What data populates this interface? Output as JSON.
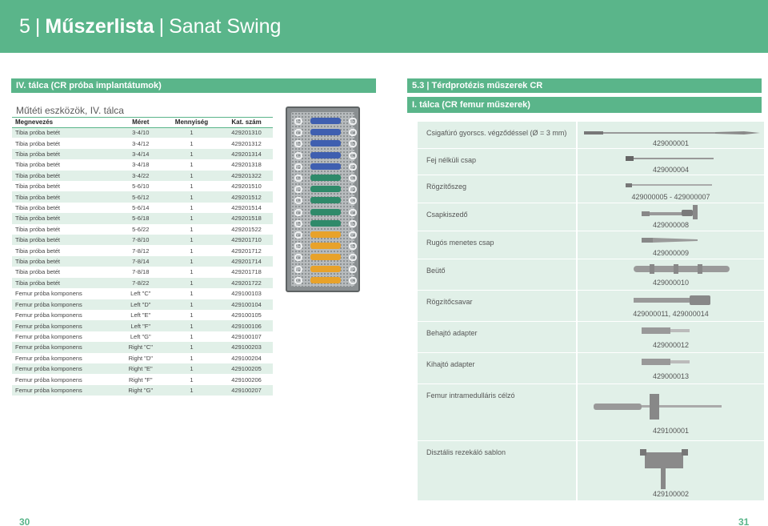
{
  "header": {
    "num": "5",
    "title": "Műszerlista",
    "subtitle": "Sanat Swing"
  },
  "left": {
    "bar_title": "IV. tálca (CR próba implantátumok)",
    "subtitle": "Műtéti eszközök, IV. tálca",
    "columns": [
      "Megnevezés",
      "Méret",
      "Mennyiség",
      "Kat. szám"
    ],
    "rows": [
      [
        "Tibia próba betét",
        "3-4/10",
        "1",
        "429201310"
      ],
      [
        "Tibia próba betét",
        "3-4/12",
        "1",
        "429201312"
      ],
      [
        "Tibia próba betét",
        "3-4/14",
        "1",
        "429201314"
      ],
      [
        "Tibia próba betét",
        "3-4/18",
        "1",
        "429201318"
      ],
      [
        "Tibia próba betét",
        "3-4/22",
        "1",
        "429201322"
      ],
      [
        "Tibia próba betét",
        "5-6/10",
        "1",
        "429201510"
      ],
      [
        "Tibia próba betét",
        "5-6/12",
        "1",
        "429201512"
      ],
      [
        "Tibia próba betét",
        "5-6/14",
        "1",
        "429201514"
      ],
      [
        "Tibia próba betét",
        "5-6/18",
        "1",
        "429201518"
      ],
      [
        "Tibia próba betét",
        "5-6/22",
        "1",
        "429201522"
      ],
      [
        "Tibia próba betét",
        "7-8/10",
        "1",
        "429201710"
      ],
      [
        "Tibia próba betét",
        "7-8/12",
        "1",
        "429201712"
      ],
      [
        "Tibia próba betét",
        "7-8/14",
        "1",
        "429201714"
      ],
      [
        "Tibia próba betét",
        "7-8/18",
        "1",
        "429201718"
      ],
      [
        "Tibia próba betét",
        "7-8/22",
        "1",
        "429201722"
      ],
      [
        "Femur próba komponens",
        "Left \"C\"",
        "1",
        "429100103"
      ],
      [
        "Femur próba komponens",
        "Left \"D\"",
        "1",
        "429100104"
      ],
      [
        "Femur próba komponens",
        "Left \"E\"",
        "1",
        "429100105"
      ],
      [
        "Femur próba komponens",
        "Left \"F\"",
        "1",
        "429100106"
      ],
      [
        "Femur próba komponens",
        "Left \"G\"",
        "1",
        "429100107"
      ],
      [
        "Femur próba komponens",
        "Right \"C\"",
        "1",
        "429100203"
      ],
      [
        "Femur próba komponens",
        "Right \"D\"",
        "1",
        "429100204"
      ],
      [
        "Femur próba komponens",
        "Right \"E\"",
        "1",
        "429100205"
      ],
      [
        "Femur próba komponens",
        "Right \"F\"",
        "1",
        "429100206"
      ],
      [
        "Femur próba komponens",
        "Right \"G\"",
        "1",
        "429100207"
      ]
    ],
    "page": "30"
  },
  "right": {
    "section_title": "5.3 | Térdprotézis műszerek CR",
    "bar_title": "I. tálca (CR femur műszerek)",
    "items": [
      {
        "name": "Csigafúró gyorscs. végződéssel (Ø = 3 mm)",
        "code": "429000001",
        "icon": "drill-bit-icon"
      },
      {
        "name": "Fej nélküli csap",
        "code": "429000004",
        "icon": "headless-pin-icon"
      },
      {
        "name": "Rögzítőszeg",
        "code": "429000005 - 429000007",
        "icon": "fixation-nail-icon"
      },
      {
        "name": "Csapkiszedő",
        "code": "429000008",
        "icon": "pin-extractor-icon"
      },
      {
        "name": "Rugós menetes csap",
        "code": "429000009",
        "icon": "threaded-pin-icon"
      },
      {
        "name": "Beütő",
        "code": "429000010",
        "icon": "impactor-icon"
      },
      {
        "name": "Rögzítőcsavar",
        "code": "429000011, 429000014",
        "icon": "fixation-screw-icon"
      },
      {
        "name": "Behajtó adapter",
        "code": "429000012",
        "icon": "driver-adapter-icon"
      },
      {
        "name": "Kihajtó adapter",
        "code": "429000013",
        "icon": "extractor-adapter-icon"
      },
      {
        "name": "Femur intramedulláris célzó",
        "code": "429100001",
        "icon": "intramedullary-guide-icon"
      },
      {
        "name": "Disztális rezekáló sablon",
        "code": "429100002",
        "icon": "distal-cutting-block-icon"
      }
    ],
    "page": "31"
  },
  "colors": {
    "accent": "#5ab58a",
    "row_tint": "#e1f0e8"
  },
  "tray_colors": [
    "#3f5fb0",
    "#2f8a6a",
    "#e8a22a"
  ]
}
